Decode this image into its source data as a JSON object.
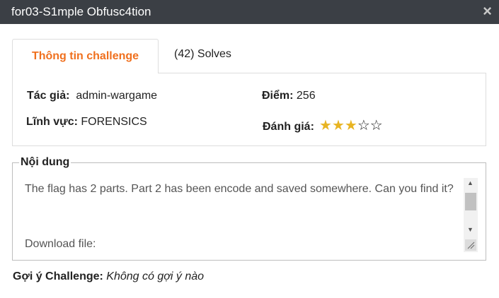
{
  "modal": {
    "title": "for03-S1mple Obfusc4tion",
    "close_symbol": "×"
  },
  "tabs": [
    {
      "label": "Thông tin challenge",
      "active": true
    },
    {
      "label": "(42) Solves",
      "active": false
    }
  ],
  "info": {
    "author_label": "Tác giả:",
    "author_value": "admin-wargame",
    "field_label": "Lĩnh vực:",
    "field_value": "FORENSICS",
    "points_label": "Điểm:",
    "points_value": "256",
    "rating_label": "Đánh giá:",
    "rating_value": 3,
    "rating_max": 5
  },
  "content": {
    "legend": "Nội dung",
    "description": "The flag has 2 parts. Part 2 has been encode and saved somewhere. Can you find it?",
    "download_label": "Download file:"
  },
  "hint": {
    "label": "Gợi ý Challenge:",
    "value": "Không có gợi ý nào"
  },
  "colors": {
    "titlebar": "#3b3f45",
    "active_tab": "#f0701e",
    "star": "#e8b422"
  }
}
